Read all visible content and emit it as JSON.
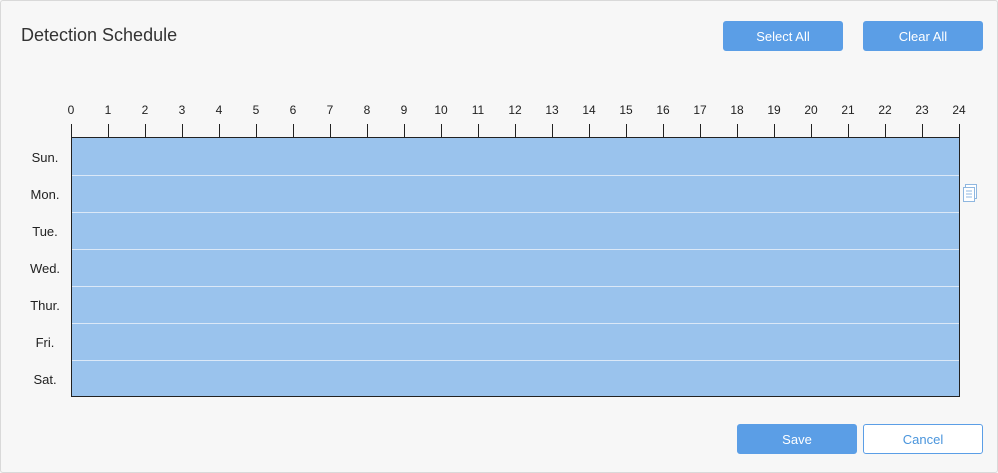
{
  "dialog": {
    "title": "Detection Schedule"
  },
  "toolbar": {
    "select_all_label": "Select All",
    "clear_all_label": "Clear All"
  },
  "footer": {
    "save_label": "Save",
    "cancel_label": "Cancel"
  },
  "hours": [
    "0",
    "1",
    "2",
    "3",
    "4",
    "5",
    "6",
    "7",
    "8",
    "9",
    "10",
    "11",
    "12",
    "13",
    "14",
    "15",
    "16",
    "17",
    "18",
    "19",
    "20",
    "21",
    "22",
    "23",
    "24"
  ],
  "days": [
    {
      "label": "Sun.",
      "scheduled": [
        [
          0,
          24
        ]
      ]
    },
    {
      "label": "Mon.",
      "scheduled": [
        [
          0,
          24
        ]
      ]
    },
    {
      "label": "Tue.",
      "scheduled": [
        [
          0,
          24
        ]
      ]
    },
    {
      "label": "Wed.",
      "scheduled": [
        [
          0,
          24
        ]
      ]
    },
    {
      "label": "Thur.",
      "scheduled": [
        [
          0,
          24
        ]
      ]
    },
    {
      "label": "Fri.",
      "scheduled": [
        [
          0,
          24
        ]
      ]
    },
    {
      "label": "Sat.",
      "scheduled": [
        [
          0,
          24
        ]
      ]
    }
  ],
  "colors": {
    "selected": "#9ac3ed",
    "primary": "#5b9ee6",
    "row_separator": "#dbe8f7"
  },
  "icons": {
    "copy": "copy-icon"
  }
}
